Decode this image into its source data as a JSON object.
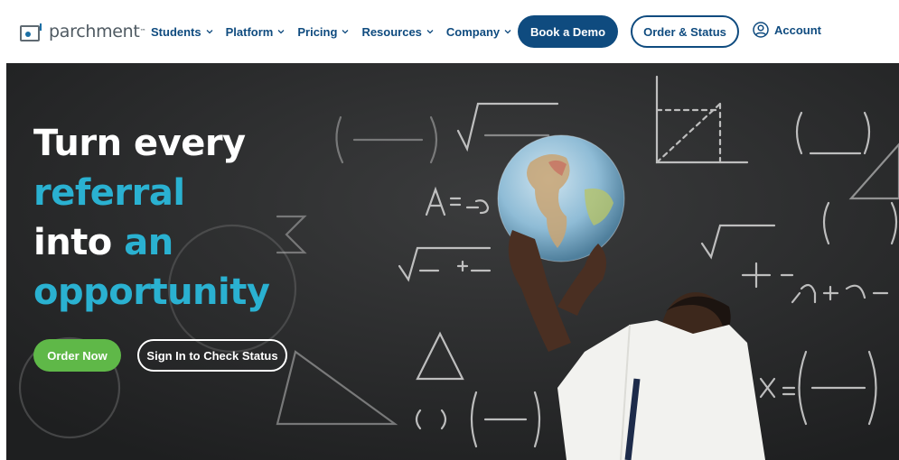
{
  "header": {
    "logo_text": "parchment",
    "logo_tm": "™",
    "nav": [
      {
        "label": "Students",
        "icon": "chevron-down-icon"
      },
      {
        "label": "Platform",
        "icon": "chevron-down-icon"
      },
      {
        "label": "Pricing",
        "icon": "chevron-down-icon"
      },
      {
        "label": "Resources",
        "icon": "chevron-down-icon"
      },
      {
        "label": "Company",
        "icon": "chevron-down-icon"
      }
    ],
    "book_demo": "Book a Demo",
    "order_status": "Order & Status",
    "account": "Account",
    "account_icon": "user-circle-icon"
  },
  "hero": {
    "line1": "Turn every",
    "line2": "referral",
    "line3a": "into",
    "line3b": "an",
    "line4": "opportunity",
    "order_now": "Order Now",
    "sign_in": "Sign In to Check Status",
    "image": "student-holding-globe-chalkboard"
  },
  "colors": {
    "brand_navy": "#0f4b7f",
    "accent_cyan": "#2ab1d1",
    "cta_green": "#5fb848",
    "chalkboard": "#2a2b2c"
  }
}
